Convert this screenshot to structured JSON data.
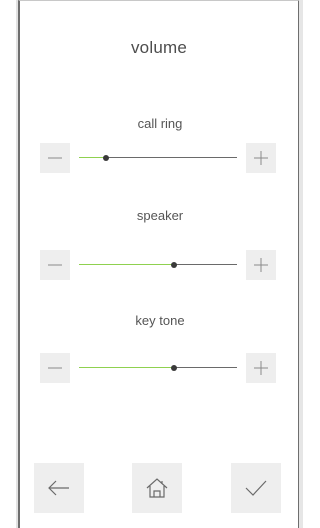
{
  "screen": {
    "title": "volume"
  },
  "sliders": [
    {
      "id": "call-ring",
      "label": "call ring",
      "level_fraction": 0.17
    },
    {
      "id": "speaker",
      "label": "speaker",
      "level_fraction": 0.6
    },
    {
      "id": "key-tone",
      "label": "key tone",
      "level_fraction": 0.6
    }
  ],
  "icons": {
    "decrease": "minus-icon",
    "increase": "plus-icon",
    "back": "arrow-left-icon",
    "home": "home-icon",
    "confirm": "checkmark-icon"
  },
  "colors": {
    "track_fill": "#8fd14f",
    "track_base": "#6a6a6a",
    "thumb": "#3a3a3a",
    "button_bg": "#eeeeee",
    "frame_border": "#6e6e6e",
    "text": "#4d4d4d"
  }
}
